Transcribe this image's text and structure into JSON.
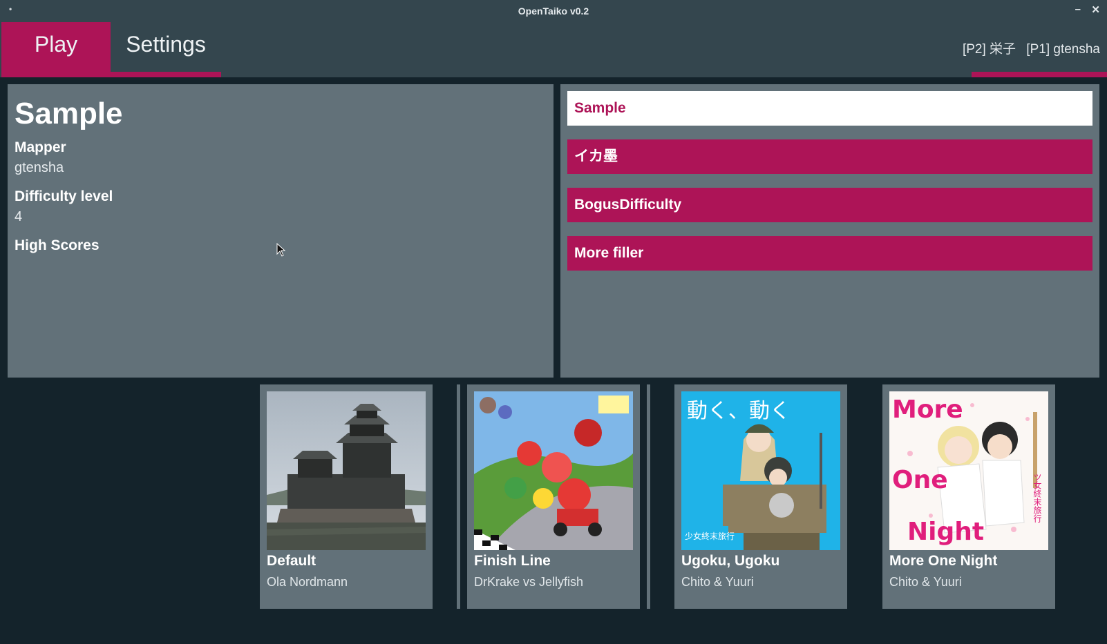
{
  "window": {
    "title": "OpenTaiko v0.2"
  },
  "tabs": {
    "play": "Play",
    "settings": "Settings"
  },
  "players": {
    "p2": "[P2] 栄子",
    "p1": "[P1] gtensha"
  },
  "info": {
    "title": "Sample",
    "mapper_label": "Mapper",
    "mapper_value": "gtensha",
    "difficulty_label": "Difficulty level",
    "difficulty_value": "4",
    "scores_label": "High Scores"
  },
  "difficulties": [
    "Sample",
    "イカ墨",
    "BogusDifficulty",
    "More filler"
  ],
  "songs": [
    {
      "title": "Default",
      "artist": "Ola Nordmann",
      "cover": "castle-photo"
    },
    {
      "title": "Finish Line",
      "artist": "DrKrake vs Jellyfish",
      "cover": "kart-artwork"
    },
    {
      "title": "Ugoku, Ugoku",
      "artist": "Chito & Yuuri",
      "cover": "anime-artwork"
    },
    {
      "title": "More One Night",
      "artist": "Chito & Yuuri",
      "cover": "anime-artwork"
    }
  ],
  "cover_text": {
    "ugoku_top": "動く、動く",
    "ugoku_bottom": "少女終末旅行",
    "night_words": [
      "More",
      "One",
      "Night"
    ],
    "night_side": "ツ女終末旅行"
  },
  "colors": {
    "accent": "#ad1457",
    "panel": "#627179",
    "bar": "#34464e",
    "background": "#14232b"
  },
  "icons": [
    "minimize-icon",
    "close-icon",
    "window-menu-icon",
    "mouse-cursor-icon"
  ]
}
